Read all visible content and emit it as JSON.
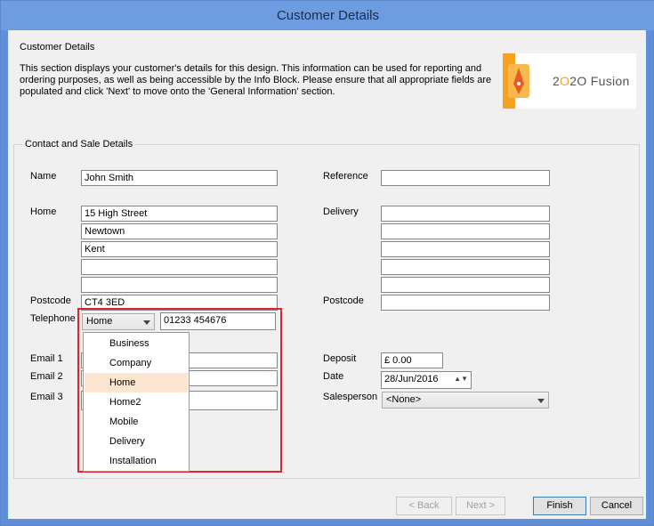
{
  "window": {
    "title": "Customer Details"
  },
  "header": {
    "title": "Customer Details",
    "description": "This section displays your customer's details for this design. This information can be used for reporting and ordering purposes, as well as being accessible by the Info Block. Please ensure that all appropriate fields are populated and click 'Next' to move onto the 'General Information' section.",
    "logo_text_pre": "2",
    "logo_text_o": "O",
    "logo_text_post": "2O Fusion"
  },
  "group": {
    "label": "Contact and Sale Details"
  },
  "left": {
    "name_label": "Name",
    "name_value": "John Smith",
    "home_label": "Home",
    "address": [
      "15 High Street",
      "Newtown",
      "Kent",
      "",
      ""
    ],
    "postcode_label": "Postcode",
    "postcode_value": "CT4 3ED",
    "telephone_label": "Telephone",
    "phone_type": "Home",
    "phone_value": "01233 454676",
    "email1_label": "Email 1",
    "email2_label": "Email 2",
    "email3_label": "Email 3"
  },
  "right": {
    "reference_label": "Reference",
    "reference_value": "",
    "delivery_label": "Delivery",
    "delivery": [
      "",
      "",
      "",
      "",
      ""
    ],
    "postcode_label": "Postcode",
    "postcode_value": "",
    "deposit_label": "Deposit",
    "deposit_value": "£ 0.00",
    "date_label": "Date",
    "date_value": "28/Jun/2016",
    "salesperson_label": "Salesperson",
    "salesperson_value": "<None>"
  },
  "phone_dropdown": {
    "options": [
      "Business",
      "Company",
      "Home",
      "Home2",
      "Mobile",
      "Delivery",
      "Installation"
    ],
    "selected": "Home"
  },
  "buttons": {
    "back": "< Back",
    "next": "Next >",
    "finish": "Finish",
    "cancel": "Cancel"
  },
  "colors": {
    "accent": "#6d9ce0",
    "highlight": "#e0262b",
    "logo": "#f4a21f"
  }
}
